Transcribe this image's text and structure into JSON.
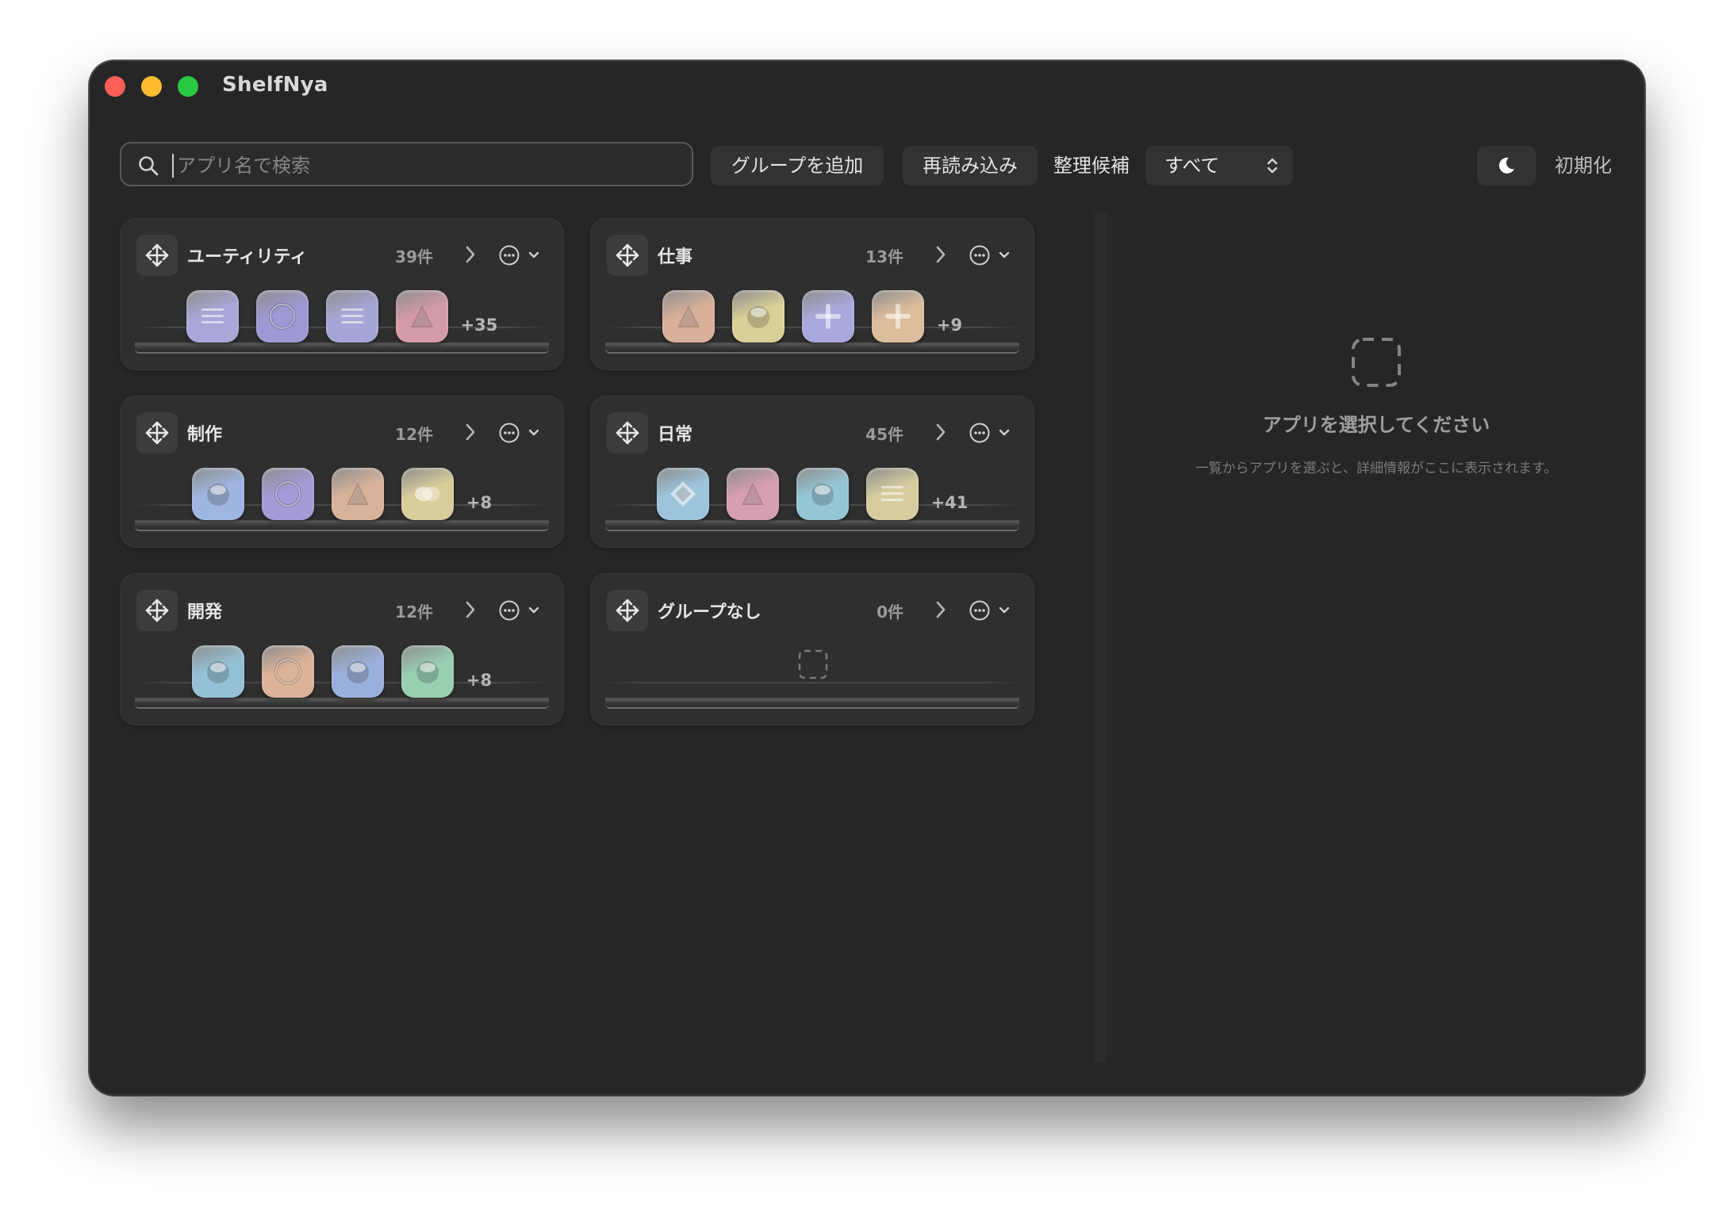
{
  "window": {
    "title": "ShelfNya"
  },
  "toolbar": {
    "search_placeholder": "アプリ名で検索",
    "search_value": "",
    "add_group_label": "グループを追加",
    "reload_label": "再読み込み",
    "filter_label": "整理候補",
    "filter_selected": "すべて",
    "reset_label": "初期化"
  },
  "groups": [
    {
      "name": "ユーティリティ",
      "count": "39件",
      "more": "+35",
      "icons": [
        {
          "shape": "lines",
          "color": "#a9a7d8"
        },
        {
          "shape": "ring",
          "color": "#9e98d4"
        },
        {
          "shape": "lines",
          "color": "#a6a6d6"
        },
        {
          "shape": "triangle",
          "color": "#d49aa8"
        }
      ]
    },
    {
      "name": "仕事",
      "count": "13件",
      "more": "+9",
      "icons": [
        {
          "shape": "triangle",
          "color": "#d9b09a"
        },
        {
          "shape": "sphere",
          "color": "#d9cf98"
        },
        {
          "shape": "cross",
          "color": "#a9a8dc"
        },
        {
          "shape": "cross",
          "color": "#dcbd9c"
        }
      ]
    },
    {
      "name": "制作",
      "count": "12件",
      "more": "+8",
      "icons": [
        {
          "shape": "sphere",
          "color": "#9fb6e0"
        },
        {
          "shape": "ring",
          "color": "#a49bd8"
        },
        {
          "shape": "triangle",
          "color": "#d8b39a"
        },
        {
          "shape": "blob",
          "color": "#d9cd9a"
        }
      ]
    },
    {
      "name": "日常",
      "count": "45件",
      "more": "+41",
      "icons": [
        {
          "shape": "diamond",
          "color": "#9cc4dc"
        },
        {
          "shape": "triangle",
          "color": "#d79fb0"
        },
        {
          "shape": "sphere",
          "color": "#95c6d6"
        },
        {
          "shape": "lines",
          "color": "#d6cc9f"
        }
      ]
    },
    {
      "name": "開発",
      "count": "12件",
      "more": "+8",
      "icons": [
        {
          "shape": "sphere",
          "color": "#94c1d5"
        },
        {
          "shape": "ring",
          "color": "#dcb298"
        },
        {
          "shape": "sphere",
          "color": "#9ab0dc"
        },
        {
          "shape": "sphere",
          "color": "#98cfb1"
        }
      ]
    },
    {
      "name": "グループなし",
      "count": "0件",
      "more": "",
      "icons": []
    }
  ],
  "detail": {
    "title": "アプリを選択してください",
    "subtitle": "一覧からアプリを選ぶと、詳細情報がここに表示されます。"
  },
  "icons": {
    "search": "magnifier-icon",
    "move": "move-arrows-icon",
    "chevron": "chevron-right-icon",
    "more": "ellipsis-circle-icon",
    "moon": "moon-icon",
    "updown": "updown-chevron-icon",
    "empty": "dashed-square-icon"
  }
}
